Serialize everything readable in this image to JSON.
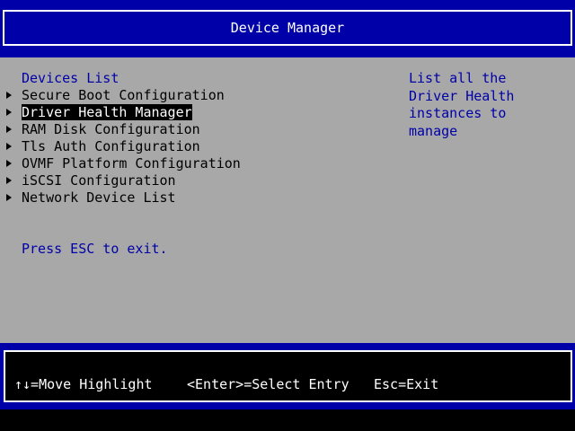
{
  "header": {
    "title": "Device Manager"
  },
  "main": {
    "section_title": "Devices List",
    "items": [
      {
        "label": "Secure Boot Configuration",
        "selected": false
      },
      {
        "label": "Driver Health Manager",
        "selected": true
      },
      {
        "label": "RAM Disk Configuration",
        "selected": false
      },
      {
        "label": "Tls Auth Configuration",
        "selected": false
      },
      {
        "label": "OVMF Platform Configuration",
        "selected": false
      },
      {
        "label": "iSCSI Configuration",
        "selected": false
      },
      {
        "label": "Network Device List",
        "selected": false
      }
    ],
    "esc_hint": "Press ESC to exit.",
    "help_text": "List all the Driver Health instances to manage"
  },
  "footer": {
    "move_hint": "↑↓=Move Highlight",
    "enter_hint": "<Enter>=Select Entry",
    "esc_hint": "Esc=Exit"
  },
  "colors": {
    "header_bg": "#0000a8",
    "body_bg": "#a8a8a8",
    "highlight_bg": "#000000",
    "highlight_fg": "#ffffff",
    "text_blue": "#0000a8"
  }
}
